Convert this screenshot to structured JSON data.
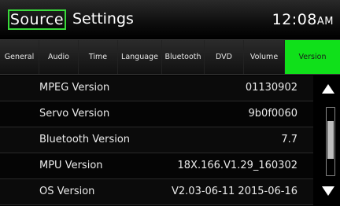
{
  "header": {
    "source_label": "Source",
    "title": "Settings",
    "time": "12:08",
    "ampm": "AM"
  },
  "tabs": [
    {
      "label": "General",
      "active": false
    },
    {
      "label": "Audio",
      "active": false
    },
    {
      "label": "Time",
      "active": false
    },
    {
      "label": "Language",
      "active": false
    },
    {
      "label": "Bluetooth",
      "active": false
    },
    {
      "label": "DVD",
      "active": false
    },
    {
      "label": "Volume",
      "active": false
    },
    {
      "label": "Version",
      "active": true
    }
  ],
  "rows": [
    {
      "label": "MPEG Version",
      "value": "01130902"
    },
    {
      "label": "Servo Version",
      "value": "9b0f0060"
    },
    {
      "label": "Bluetooth Version",
      "value": "7.7"
    },
    {
      "label": "MPU Version",
      "value": "18X.166.V1.29_160302"
    },
    {
      "label": "OS Version",
      "value": "V2.03-06-11 2015-06-16"
    }
  ],
  "scrollbar": {
    "up_icon": "triangle-up-icon",
    "down_icon": "triangle-down-icon",
    "thumb_position": 0.45,
    "thumb_size": 0.55
  },
  "colors": {
    "accent": "#10e01a",
    "source_border": "#39d83a"
  }
}
